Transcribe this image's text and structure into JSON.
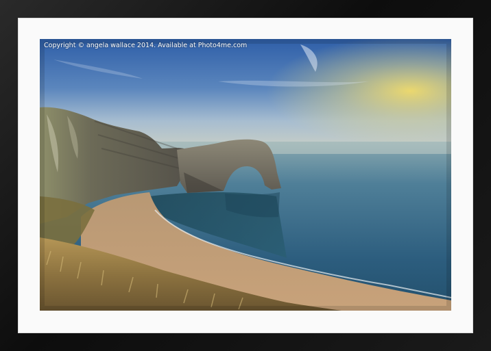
{
  "photo": {
    "copyright_text": "Copyright © angela wallace 2014. Available at Photo4me.com",
    "subject": "coastal sea arch at sunset"
  },
  "colors": {
    "frame": "#141414",
    "mount": "#fafafa",
    "sky_top": "#2f5fa8",
    "sunset_glow": "#e6d36a",
    "sea": "#2b5f7f"
  }
}
